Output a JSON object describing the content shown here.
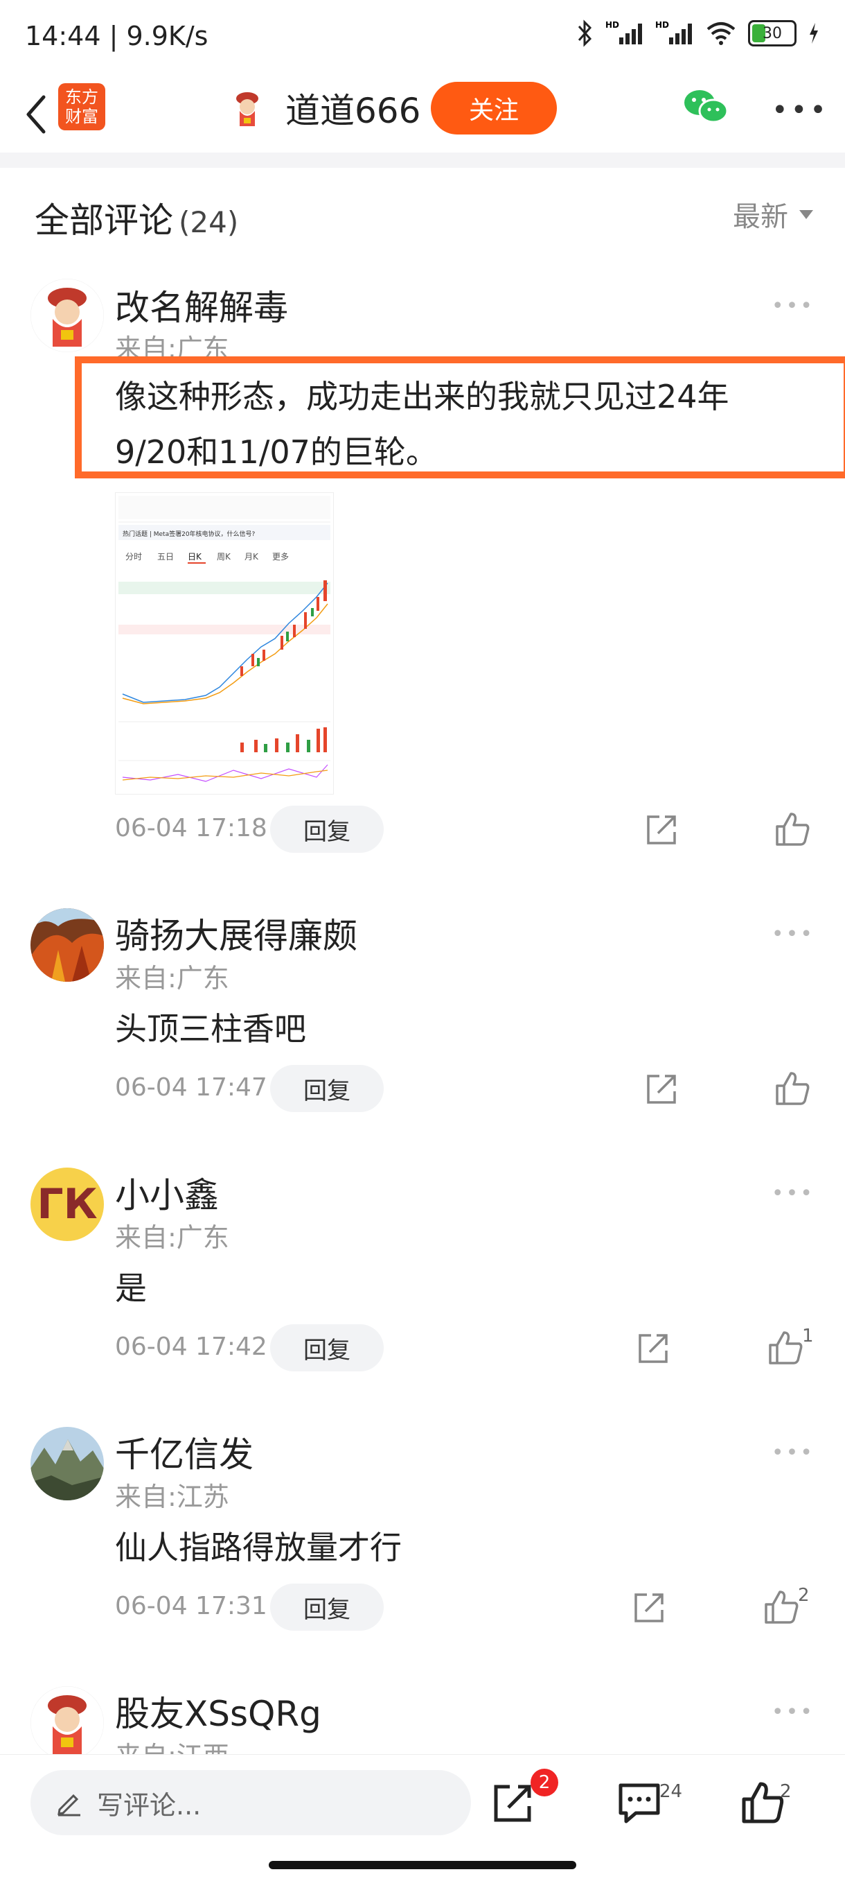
{
  "status_bar": {
    "time_speed": "14:44 | 9.9K/s",
    "battery": "30"
  },
  "nav": {
    "logo_line1": "东方",
    "logo_line2": "财富",
    "title": "道道666",
    "follow": "关注"
  },
  "section": {
    "title": "全部评论",
    "count": "(24)",
    "sort": "最新"
  },
  "comments": [
    {
      "name": "改名解解毒",
      "from": "来自:广东",
      "text_line1": "像这种形态，成功走出来的我就只见过24年",
      "text_line2": "9/20和11/07的巨轮。",
      "time": "06-04 17:18",
      "reply": "回复",
      "likes": ""
    },
    {
      "name": "骑扬大展得廉颇",
      "from": "来自:广东",
      "text_line1": "头顶三柱香吧",
      "time": "06-04 17:47",
      "reply": "回复",
      "likes": ""
    },
    {
      "name": "小小鑫",
      "avatar_text": "ГК",
      "from": "来自:广东",
      "text_line1": "是",
      "time": "06-04 17:42",
      "reply": "回复",
      "likes": "1"
    },
    {
      "name": "千亿信发",
      "from": "来自:江苏",
      "text_line1": "仙人指路得放量才行",
      "time": "06-04 17:31",
      "reply": "回复",
      "likes": "2"
    },
    {
      "name": "股友XSsQRg",
      "from": "来自:江西"
    }
  ],
  "thumb": {
    "tabs": [
      "分时",
      "五日",
      "日K",
      "周K",
      "月K",
      "更多"
    ],
    "headline": "热门话题 | Meta签署20年核电协议，什么信号?"
  },
  "bottom": {
    "write_placeholder": "写评论...",
    "share_badge": "2",
    "comment_count": "24",
    "like_count": "2"
  },
  "colors": {
    "accent": "#ff5a12",
    "highlight_border": "#ff6a2a",
    "badge": "#f02424"
  }
}
